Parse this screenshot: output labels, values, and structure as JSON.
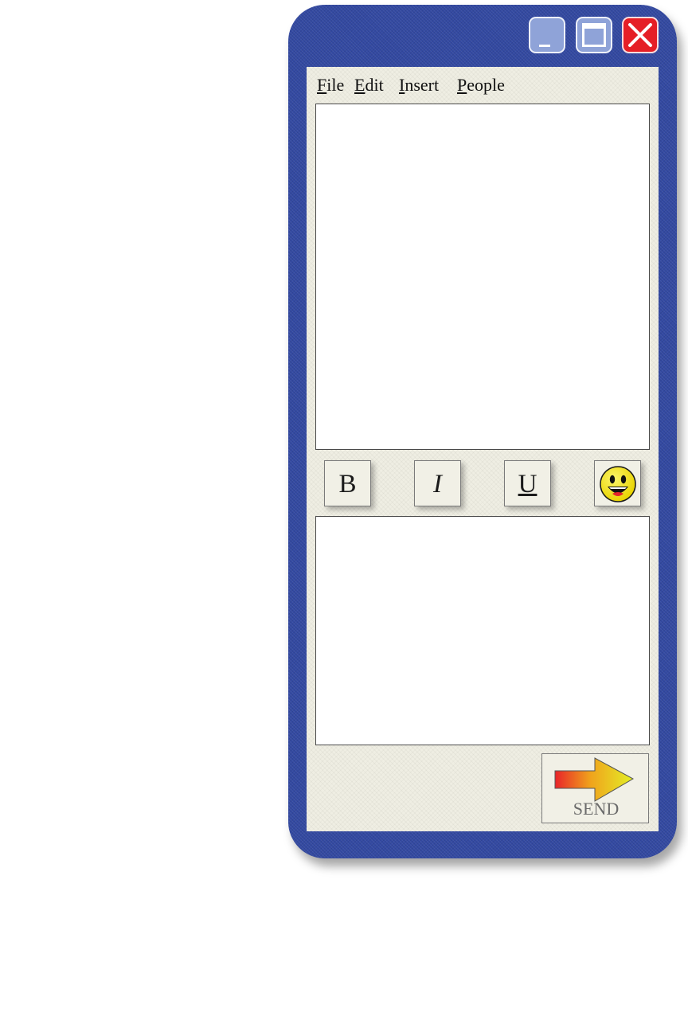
{
  "title_bar": {
    "minimize_icon": "minimize-icon",
    "maximize_icon": "maximize-icon",
    "close_icon": "close-icon"
  },
  "menu": {
    "items": [
      {
        "accel": "F",
        "rest": "ile"
      },
      {
        "accel": "E",
        "rest": "dit"
      },
      {
        "accel": "I",
        "rest": "nsert"
      },
      {
        "accel": "P",
        "rest": "eople"
      }
    ]
  },
  "chat_log": {
    "text": ""
  },
  "format_toolbar": {
    "bold_label": "B",
    "italic_label": "I",
    "underline_label": "U",
    "emoji_icon": "smiley-face-icon"
  },
  "compose": {
    "value": ""
  },
  "send_button": {
    "label": "SEND",
    "icon": "arrow-right-icon"
  },
  "colors": {
    "window_frame": "#3349a1",
    "client_bg": "#efeee3",
    "close_button": "#e51f26",
    "title_buttons": "#8fa3d8"
  }
}
